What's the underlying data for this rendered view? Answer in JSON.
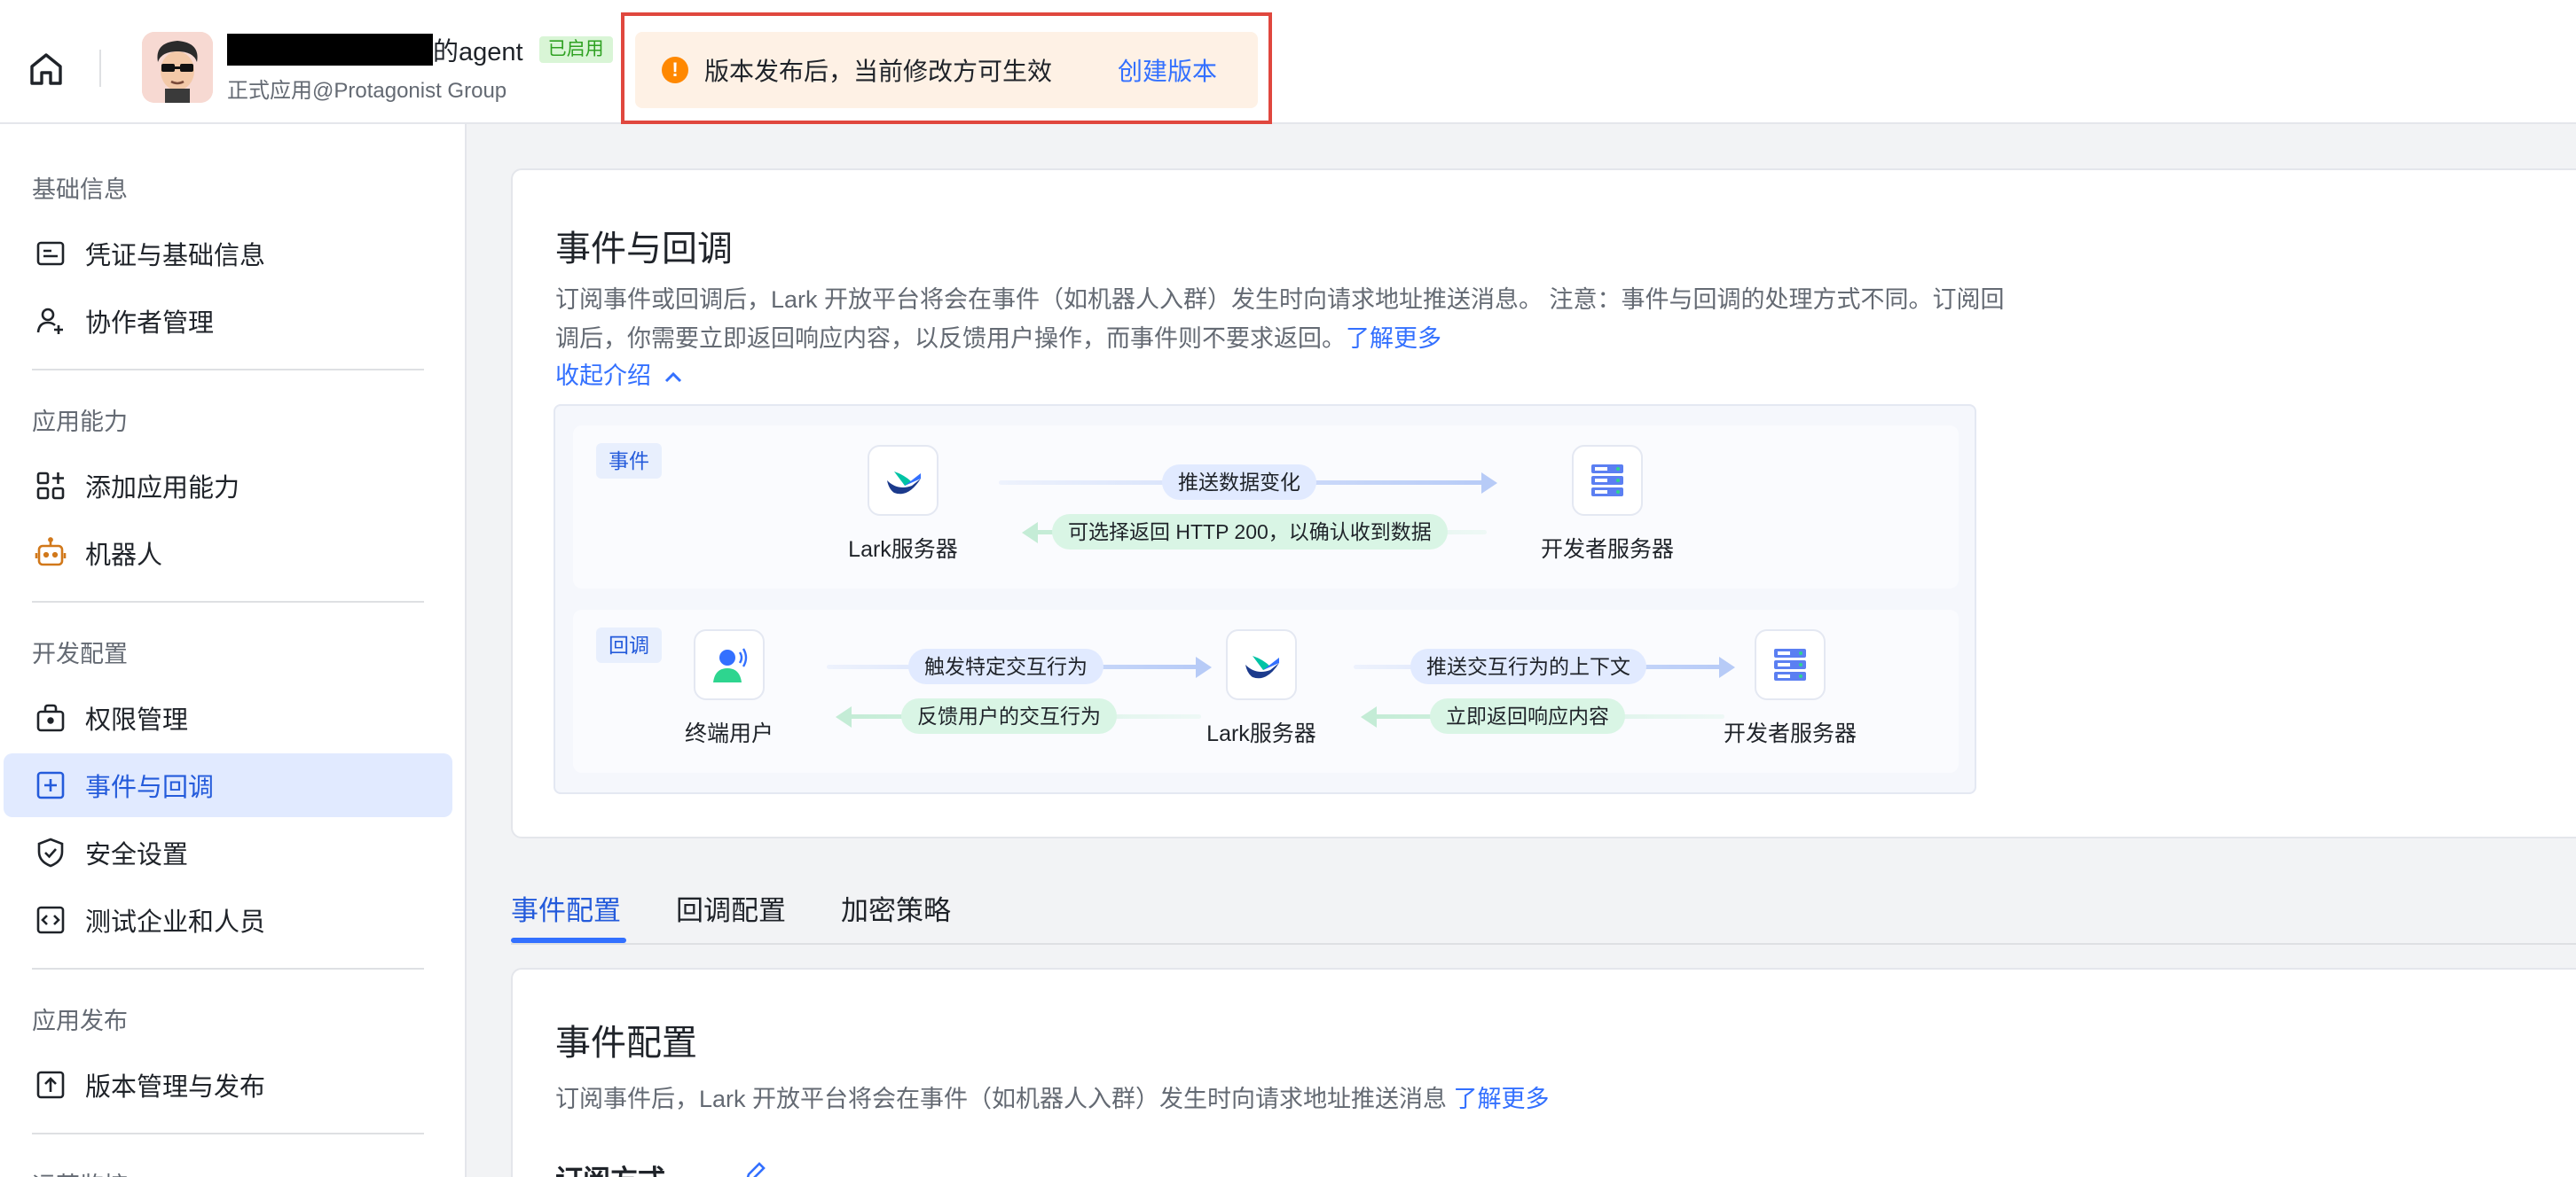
{
  "header": {
    "app_name": "的agent",
    "status": "已启用",
    "org": "正式应用@Protagonist Group",
    "notice": {
      "text": "版本发布后，当前修改方可生效",
      "link": "创建版本",
      "icon": "warning-icon"
    }
  },
  "sidebar": {
    "groups": [
      {
        "title": "基础信息",
        "items": [
          {
            "label": "凭证与基础信息",
            "icon": "credential-icon"
          },
          {
            "label": "协作者管理",
            "icon": "add-user-icon"
          }
        ]
      },
      {
        "title": "应用能力",
        "items": [
          {
            "label": "添加应用能力",
            "icon": "app-grid-icon"
          },
          {
            "label": "机器人",
            "icon": "robot-icon"
          }
        ]
      },
      {
        "title": "开发配置",
        "items": [
          {
            "label": "权限管理",
            "icon": "lock-bag-icon"
          },
          {
            "label": "事件与回调",
            "icon": "event-icon",
            "active": true
          },
          {
            "label": "安全设置",
            "icon": "shield-icon"
          },
          {
            "label": "测试企业和人员",
            "icon": "code-icon"
          }
        ]
      },
      {
        "title": "应用发布",
        "items": [
          {
            "label": "版本管理与发布",
            "icon": "upload-icon"
          }
        ]
      },
      {
        "title": "运营监控",
        "items": []
      }
    ]
  },
  "intro": {
    "title": "事件与回调",
    "desc": "订阅事件或回调后，Lark 开放平台将会在事件（如机器人入群）发生时向请求地址推送消息。 注意：事件与回调的处理方式不同。订阅回调后，你需要立即返回响应内容，以反馈用户操作，而事件则不要求返回。",
    "learn_more": "了解更多",
    "collapse": "收起介绍"
  },
  "flow": {
    "event": {
      "tag": "事件",
      "source": "Lark服务器",
      "target": "开发者服务器",
      "forward": "推送数据变化",
      "backward": "可选择返回 HTTP 200，以确认收到数据"
    },
    "callback": {
      "tag": "回调",
      "user": "终端用户",
      "server": "Lark服务器",
      "target": "开发者服务器",
      "fwd1": "触发特定交互行为",
      "bwd1": "反馈用户的交互行为",
      "fwd2": "推送交互行为的上下文",
      "bwd2": "立即返回响应内容"
    }
  },
  "tabs": [
    "事件配置",
    "回调配置",
    "加密策略"
  ],
  "config": {
    "title": "事件配置",
    "desc": "订阅事件后，Lark 开放平台将会在事件（如机器人入群）发生时向请求地址推送消息",
    "learn_more": "了解更多",
    "subscribe_label": "订阅方式"
  },
  "colors": {
    "accent": "#3370ff",
    "active_bg": "#e1eaff",
    "notice_border": "#e0473e",
    "notice_bg": "#fef1e5",
    "warning": "#ff8800"
  }
}
